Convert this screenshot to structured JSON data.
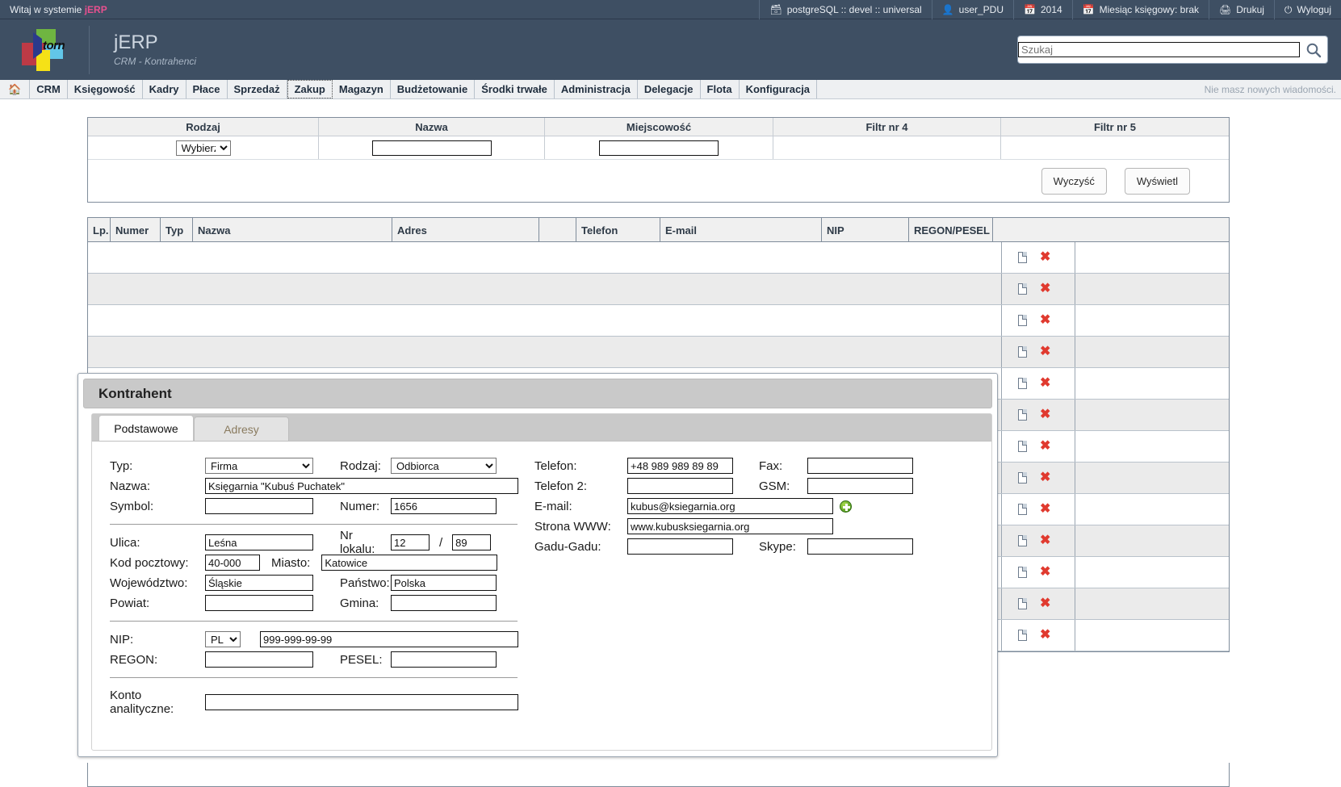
{
  "topbar": {
    "welcome_prefix": "Witaj w systemie ",
    "welcome_brand": "jERP",
    "items": [
      {
        "icon": "database-icon",
        "label": "postgreSQL :: devel :: universal"
      },
      {
        "icon": "user-icon",
        "label": "user_PDU"
      },
      {
        "icon": "calendar-icon",
        "label": "2014"
      },
      {
        "icon": "calendar-icon",
        "label": "Miesiąc księgowy: brak"
      },
      {
        "icon": "printer-icon",
        "label": "Drukuj"
      },
      {
        "icon": "power-icon",
        "label": "Wyloguj"
      }
    ]
  },
  "header": {
    "logo_text": "torn",
    "title": "jERP",
    "subtitle": "CRM - Kontrahenci",
    "search_placeholder": "Szukaj",
    "search_value": "",
    "search_icon": "search-icon"
  },
  "nav": {
    "home_icon": "home-icon",
    "items": [
      {
        "label": "CRM",
        "active": false
      },
      {
        "label": "Księgowość",
        "active": false
      },
      {
        "label": "Kadry",
        "active": false
      },
      {
        "label": "Płace",
        "active": false
      },
      {
        "label": "Sprzedaż",
        "active": false
      },
      {
        "label": "Zakup",
        "active": true
      },
      {
        "label": "Magazyn",
        "active": false
      },
      {
        "label": "Budżetowanie",
        "active": false
      },
      {
        "label": "Środki trwałe",
        "active": false
      },
      {
        "label": "Administracja",
        "active": false
      },
      {
        "label": "Delegacje",
        "active": false
      },
      {
        "label": "Flota",
        "active": false
      },
      {
        "label": "Konfiguracja",
        "active": false
      }
    ],
    "messages": "Nie masz nowych wiadomości."
  },
  "filters": {
    "columns": [
      {
        "title": "Rodzaj",
        "type": "select",
        "value": "Wybierz"
      },
      {
        "title": "Nazwa",
        "type": "text",
        "value": ""
      },
      {
        "title": "Miejscowość",
        "type": "text",
        "value": ""
      },
      {
        "title": "Filtr nr 4",
        "type": "none",
        "value": ""
      },
      {
        "title": "Filtr nr 5",
        "type": "none",
        "value": ""
      }
    ],
    "clear_button": "Wyczyść",
    "show_button": "Wyświetl"
  },
  "table": {
    "headers": [
      "Lp.",
      "Numer",
      "Typ",
      "Nazwa",
      "Adres",
      "",
      "Telefon",
      "E-mail",
      "NIP",
      "REGON/PESEL",
      ""
    ],
    "row_count": 13,
    "edit_icon": "document-icon",
    "delete_icon": "delete-x-icon"
  },
  "modal": {
    "title": "Kontrahent",
    "tabs": [
      {
        "label": "Podstawowe",
        "active": true
      },
      {
        "label": "Adresy",
        "active": false
      }
    ],
    "fields": {
      "typ_label": "Typ:",
      "typ_value": "Firma",
      "rodzaj_label": "Rodzaj:",
      "rodzaj_value": "Odbiorca",
      "nazwa_label": "Nazwa:",
      "nazwa_value": "Księgarnia \"Kubuś Puchatek\"",
      "symbol_label": "Symbol:",
      "symbol_value": "",
      "numer_label": "Numer:",
      "numer_value": "1656",
      "ulica_label": "Ulica:",
      "ulica_value": "Leśna",
      "nr_lokalu_label": "Nr lokalu:",
      "nr_lokalu_value": "12",
      "nr_lokalu_sep": "/",
      "nr_lokalu_value2": "89",
      "kod_label": "Kod pocztowy:",
      "kod_value": "40-000",
      "miasto_label": "Miasto:",
      "miasto_value": "Katowice",
      "wojewodztwo_label": "Województwo:",
      "wojewodztwo_value": "Śląskie",
      "panstwo_label": "Państwo:",
      "panstwo_value": "Polska",
      "powiat_label": "Powiat:",
      "powiat_value": "",
      "gmina_label": "Gmina:",
      "gmina_value": "",
      "nip_label": "NIP:",
      "nip_prefix": "PL",
      "nip_value": "999-999-99-99",
      "regon_label": "REGON:",
      "regon_value": "",
      "pesel_label": "PESEL:",
      "pesel_value": "",
      "konto_label": "Konto analityczne:",
      "konto_value": "",
      "telefon_label": "Telefon:",
      "telefon_value": "+48 989 989 89 89",
      "fax_label": "Fax:",
      "fax_value": "",
      "telefon2_label": "Telefon 2:",
      "telefon2_value": "",
      "gsm_label": "GSM:",
      "gsm_value": "",
      "email_label": "E-mail:",
      "email_value": "kubus@ksiegarnia.org",
      "email_add_icon": "add-plus-icon",
      "www_label": "Strona WWW:",
      "www_value": "www.kubusksiegarnia.org",
      "gadu_label": "Gadu-Gadu:",
      "gadu_value": "",
      "skype_label": "Skype:",
      "skype_value": ""
    }
  },
  "colors": {
    "header_bg": "#3e4f63",
    "brand_pink": "#e8508f",
    "accent_red": "#e03a2f",
    "accent_green": "#4f9c1e"
  }
}
